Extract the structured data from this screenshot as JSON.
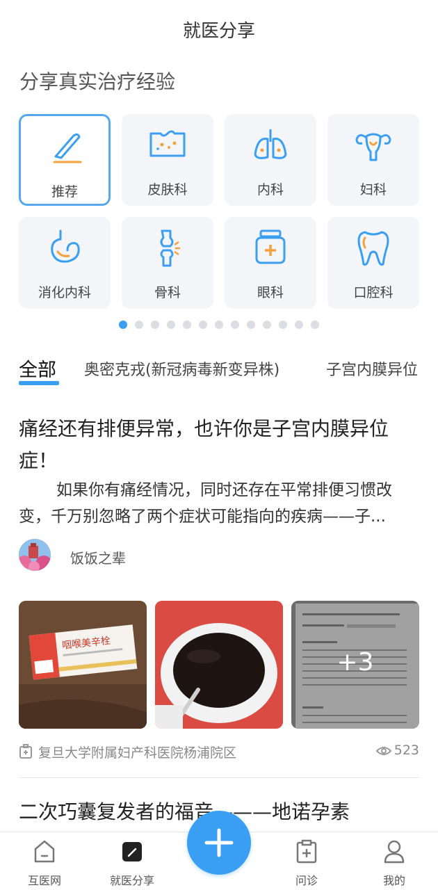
{
  "header": {
    "title": "就医分享"
  },
  "subheading": "分享真实治疗经验",
  "categories": [
    {
      "label": "推荐",
      "icon": "scalpel-icon",
      "active": true
    },
    {
      "label": "皮肤科",
      "icon": "skin-icon"
    },
    {
      "label": "内科",
      "icon": "lungs-icon"
    },
    {
      "label": "妇科",
      "icon": "uterus-icon"
    },
    {
      "label": "消化内科",
      "icon": "stomach-icon"
    },
    {
      "label": "骨科",
      "icon": "bone-joint-icon"
    },
    {
      "label": "眼科",
      "icon": "medicine-box-icon"
    },
    {
      "label": "口腔科",
      "icon": "tooth-icon"
    }
  ],
  "pagination": {
    "total": 13,
    "current": 1
  },
  "tabs": [
    {
      "label": "全部",
      "active": true
    },
    {
      "label": "奥密克戎(新冠病毒新变异株)"
    },
    {
      "label": "子宫内膜异位"
    }
  ],
  "post1": {
    "title": "痛经还有排便异常，也许你是子宫内膜异位症！",
    "excerpt": "如果你有痛经情况，同时还存在平常排便习惯改变，千万别忽略了两个症状可能指向的疾病——子...",
    "author": "饭饭之辈",
    "photos": [
      {
        "text": "咽喉美辛栓"
      },
      {
        "text": ""
      },
      {
        "text": "",
        "more": "+3"
      }
    ],
    "hospital": "复旦大学附属妇产科医院杨浦院区",
    "views": "523"
  },
  "post2": {
    "title": "二次巧囊复发者的福音———地诺孕素"
  },
  "bottom_nav": [
    {
      "label": "互医网",
      "icon": "home-icon"
    },
    {
      "label": "就医分享",
      "icon": "share-edit-icon",
      "active": true
    },
    {
      "label": "问诊",
      "icon": "clipboard-plus-icon"
    },
    {
      "label": "我的",
      "icon": "person-icon"
    }
  ],
  "colors": {
    "accent": "#3a9ff2",
    "tile_bg": "#f3f5f8",
    "icon_orange": "#f5a03a"
  }
}
